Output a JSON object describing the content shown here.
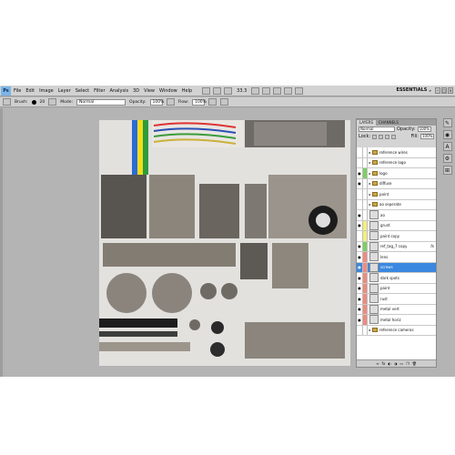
{
  "app": {
    "logo": "Ps"
  },
  "menu": [
    "File",
    "Edit",
    "Image",
    "Layer",
    "Select",
    "Filter",
    "Analysis",
    "3D",
    "View",
    "Window",
    "Help"
  ],
  "zoom": "33.3",
  "workspace": "ESSENTIALS",
  "window_controls": [
    "–",
    "□",
    "×"
  ],
  "options": {
    "brush_label": "Brush:",
    "brush_size": "20",
    "mode_label": "Mode:",
    "mode_value": "Normal",
    "opacity_label": "Opacity:",
    "opacity_value": "100%",
    "flow_label": "Flow:",
    "flow_value": "100%"
  },
  "layers_panel": {
    "tabs": [
      "LAYERS",
      "CHANNELS"
    ],
    "blend": "Normal",
    "opacity_label": "Opacity:",
    "opacity": "100%",
    "lock_label": "Lock:",
    "fill_label": "Fill:",
    "fill": "100%",
    "layers": [
      {
        "name": "reference wires",
        "type": "folder",
        "eye": "",
        "color": "#ffffff"
      },
      {
        "name": "reference logo",
        "type": "folder",
        "eye": "",
        "color": "#ffffff"
      },
      {
        "name": "logo",
        "type": "folder",
        "eye": "●",
        "color": "#7ad15f"
      },
      {
        "name": "diffuse",
        "type": "folder",
        "eye": "●",
        "color": "#ffffff"
      },
      {
        "name": "paint",
        "type": "folder",
        "eye": "",
        "color": "#ffffff"
      },
      {
        "name": "ao seperate",
        "type": "folder",
        "eye": "",
        "color": "#ffffff"
      },
      {
        "name": "ao",
        "type": "layer",
        "eye": "●",
        "color": "#ffffff"
      },
      {
        "name": "grunt",
        "type": "layer",
        "eye": "●",
        "color": "#f5ef7a"
      },
      {
        "name": "paint copy",
        "type": "layer",
        "eye": "",
        "color": "#f5ef7a"
      },
      {
        "name": "ref_tag_7 copy",
        "type": "layer",
        "eye": "●",
        "color": "#7ad15f",
        "fx": "fx"
      },
      {
        "name": "lens",
        "type": "layer",
        "eye": "●",
        "color": "#f08a80"
      },
      {
        "name": "screws",
        "type": "layer",
        "eye": "●",
        "color": "#f08a80",
        "selected": true
      },
      {
        "name": "dark spots",
        "type": "layer",
        "eye": "●",
        "color": "#f08a80"
      },
      {
        "name": "paint",
        "type": "layer",
        "eye": "●",
        "color": "#f08a80"
      },
      {
        "name": "rust",
        "type": "layer",
        "eye": "●",
        "color": "#f08a80"
      },
      {
        "name": "metal vert",
        "type": "layer",
        "eye": "●",
        "color": "#f08a80"
      },
      {
        "name": "metal horiz",
        "type": "layer",
        "eye": "●",
        "color": "#f08a80"
      },
      {
        "name": "reference cameras",
        "type": "folder",
        "eye": "",
        "color": "#ffffff"
      }
    ],
    "footer": [
      "∞",
      "fx",
      "◐",
      "◑",
      "▭",
      "❐",
      "🗑"
    ]
  },
  "side_icons": [
    "✎",
    "◉",
    "A",
    "⚙",
    "⊞"
  ]
}
